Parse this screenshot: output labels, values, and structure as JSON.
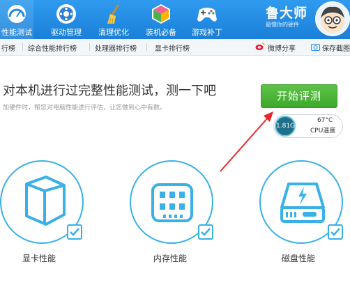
{
  "topnav": {
    "items": [
      {
        "label": "性能测试",
        "icon": "performance-gauge-icon"
      },
      {
        "label": "驱动管理",
        "icon": "driver-gear-icon"
      },
      {
        "label": "清理优化",
        "icon": "broom-icon"
      },
      {
        "label": "装机必备",
        "icon": "cube-icon"
      },
      {
        "label": "游戏补丁",
        "icon": "gamepad-icon"
      }
    ],
    "active_index": 0,
    "brand_name": "鲁大师",
    "brand_slogan": "最懂你的硬件"
  },
  "subnav": {
    "items": [
      "行榜",
      "综合性能排行榜",
      "处理器排行榜",
      "显卡排行榜"
    ],
    "weibo_share": "微博分享",
    "save_label": "保存截图"
  },
  "main": {
    "title": "对本机进行过完整性能测试，测一下吧",
    "description": "加硬件时，帮您对电脑性能进行评估，让您做到心中有数。",
    "start_button": "开始评测",
    "monitor": {
      "speed": "1.81G",
      "temperature": "67°C",
      "temp_label": "CPU温度"
    }
  },
  "tests": [
    {
      "label": "显卡性能",
      "icon": "graphics-cube-icon",
      "checked": true
    },
    {
      "label": "内存性能",
      "icon": "memory-chip-icon",
      "checked": true
    },
    {
      "label": "磁盘性能",
      "icon": "disk-drive-icon",
      "checked": true
    }
  ],
  "colors": {
    "topbar": "#1f8ae0",
    "accent_blue": "#39b0e8",
    "start_green": "#4db53a",
    "arrow_red": "#e8282b"
  }
}
